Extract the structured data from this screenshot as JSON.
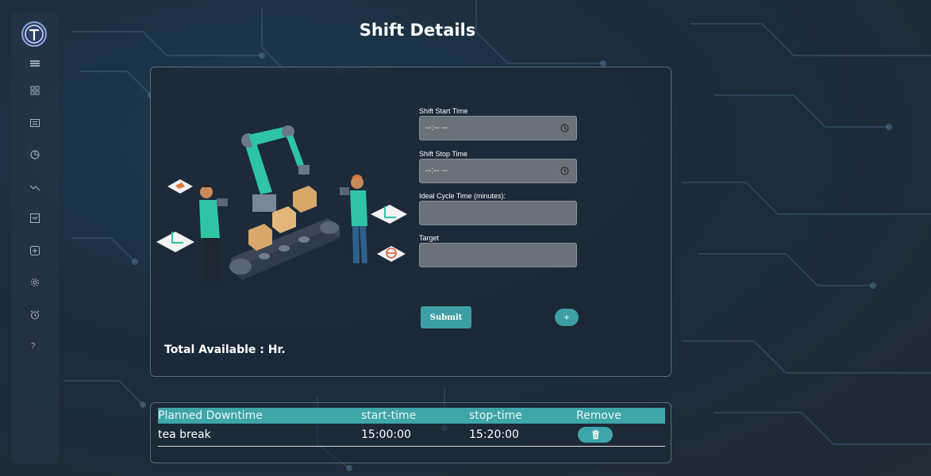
{
  "page": {
    "title": "Shift Details"
  },
  "sidebar": {
    "icons": [
      "menu-icon",
      "dashboard-icon",
      "list-icon",
      "pie-chart-icon",
      "trend-icon",
      "report-icon",
      "add-icon",
      "settings-icon",
      "alarm-icon",
      "help-icon"
    ],
    "help_label": "?"
  },
  "form": {
    "shift_start": {
      "label": "Shift Start Time",
      "placeholder": "--:-- --"
    },
    "shift_stop": {
      "label": "Shift Stop Time",
      "placeholder": "--:-- --"
    },
    "ideal_cycle": {
      "label": "Ideal Cycle Time (minutes):",
      "value": ""
    },
    "target": {
      "label": "Target",
      "value": ""
    },
    "submit_label": "Submit",
    "add_label": "+",
    "total_available": "Total Available : Hr."
  },
  "downtime_table": {
    "columns": [
      "Planned Downtime",
      "start-time",
      "stop-time",
      "Remove"
    ],
    "rows": [
      {
        "name": "tea break",
        "start": "15:00:00",
        "stop": "15:20:00"
      }
    ]
  },
  "colors": {
    "accent": "#3ea5a8",
    "field": "#6b7179",
    "background": "#1d2f40"
  }
}
